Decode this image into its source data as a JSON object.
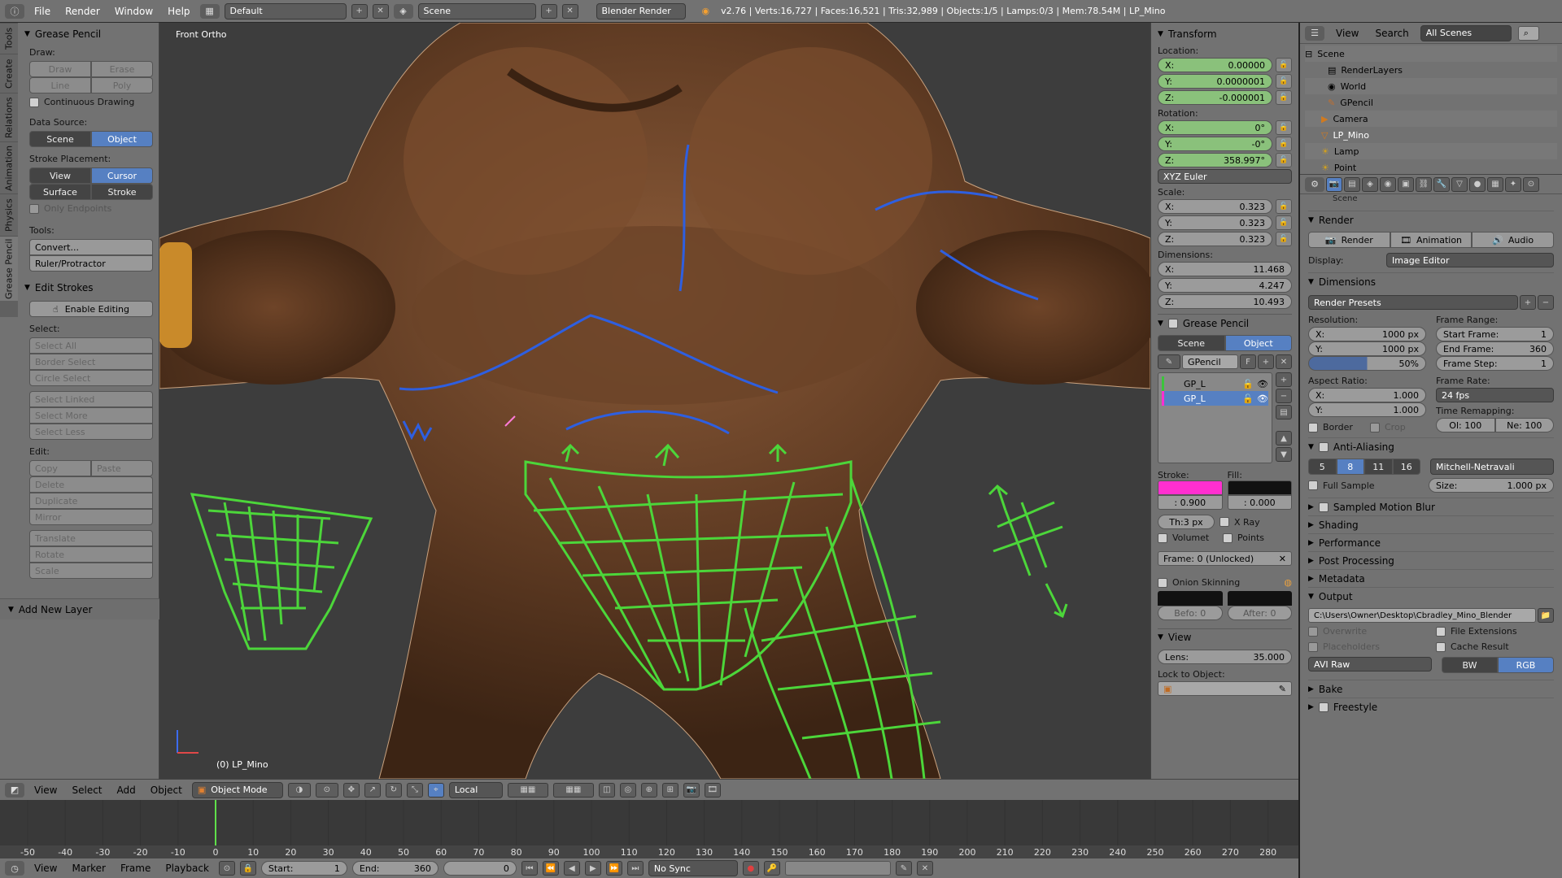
{
  "topbar": {
    "menus": [
      "File",
      "Render",
      "Window",
      "Help"
    ],
    "layout": "Default",
    "scene": "Scene",
    "engine": "Blender Render",
    "stats": "v2.76 | Verts:16,727 | Faces:16,521 | Tris:32,989 | Objects:1/5 | Lamps:0/3 | Mem:78.54M | LP_Mino"
  },
  "toolshelf": {
    "tabs": [
      "Tools",
      "Create",
      "Relations",
      "Animation",
      "Physics",
      "Grease Pencil"
    ],
    "panel_title": "Grease Pencil",
    "draw_label": "Draw:",
    "draw_buttons": [
      "Draw",
      "Erase",
      "Line",
      "Poly"
    ],
    "continuous_drawing": "Continuous Drawing",
    "data_source_label": "Data Source:",
    "data_source": [
      "Scene",
      "Object"
    ],
    "stroke_placement_label": "Stroke Placement:",
    "stroke_placement": [
      "View",
      "Cursor",
      "Surface",
      "Stroke"
    ],
    "only_endpoints": "Only Endpoints",
    "tools_label": "Tools:",
    "tools": [
      "Convert...",
      "Ruler/Protractor"
    ],
    "edit_strokes_title": "Edit Strokes",
    "enable_editing": "Enable Editing",
    "select_label": "Select:",
    "select_items": [
      "Select All",
      "Border Select",
      "Circle Select",
      "Select Linked",
      "Select More",
      "Select Less"
    ],
    "edit_label": "Edit:",
    "copy": "Copy",
    "paste": "Paste",
    "edit_items": [
      "Delete",
      "Duplicate",
      "Mirror",
      "Translate",
      "Rotate",
      "Scale"
    ],
    "add_new_layer": "Add New Layer"
  },
  "viewport": {
    "view_name": "Front Ortho",
    "object_label": "(0) LP_Mino"
  },
  "npanel": {
    "transform_title": "Transform",
    "location_label": "Location:",
    "location": [
      {
        "k": "X:",
        "v": "0.00000"
      },
      {
        "k": "Y:",
        "v": "0.0000001"
      },
      {
        "k": "Z:",
        "v": "-0.000001"
      }
    ],
    "rotation_label": "Rotation:",
    "rotation": [
      {
        "k": "X:",
        "v": "0°"
      },
      {
        "k": "Y:",
        "v": "-0°"
      },
      {
        "k": "Z:",
        "v": "358.997°"
      }
    ],
    "rotation_mode": "XYZ Euler",
    "scale_label": "Scale:",
    "scale": [
      {
        "k": "X:",
        "v": "0.323"
      },
      {
        "k": "Y:",
        "v": "0.323"
      },
      {
        "k": "Z:",
        "v": "0.323"
      }
    ],
    "dimensions_label": "Dimensions:",
    "dimensions": [
      {
        "k": "X:",
        "v": "11.468"
      },
      {
        "k": "Y:",
        "v": "4.247"
      },
      {
        "k": "Z:",
        "v": "10.493"
      }
    ],
    "gp_title": "Grease Pencil",
    "gp_source": [
      "Scene",
      "Object"
    ],
    "gp_name": "GPencil",
    "gp_f": "F",
    "layers": [
      "GP_L",
      "GP_L"
    ],
    "stroke_label": "Stroke:",
    "fill_label": "Fill:",
    "stroke_color": "#ff2fd0",
    "fill_color": "#111111",
    "stroke_alpha": ": 0.900",
    "fill_alpha": ": 0.000",
    "thickness": "Th:3 px",
    "xray": "X Ray",
    "volumetric": "Volumet",
    "points": "Points",
    "frame": "Frame: 0 (Unlocked)",
    "onion": "Onion Skinning",
    "before": "Befo: 0",
    "after": "After: 0",
    "view_title": "View",
    "lens": "Lens:",
    "lens_value": "35.000",
    "lock_to_object": "Lock to Object:"
  },
  "outliner": {
    "menus": [
      "View",
      "Search"
    ],
    "scenes": "All Scenes",
    "items": [
      "Scene",
      "RenderLayers",
      "World",
      "GPencil",
      "Camera",
      "LP_Mino",
      "Lamp",
      "Point"
    ]
  },
  "props": {
    "breadcrumb": "Scene",
    "render_title": "Render",
    "render_buttons": [
      "Render",
      "Animation",
      "Audio"
    ],
    "display_label": "Display:",
    "display": "Image Editor",
    "dimensions_title": "Dimensions",
    "presets": "Render Presets",
    "resolution_label": "Resolution:",
    "res_x": "1000 px",
    "res_y": "1000 px",
    "res_pct": "50%",
    "frame_range_label": "Frame Range:",
    "start_frame": "Start Frame:",
    "start_frame_val": "1",
    "end_frame": "End Frame:",
    "end_frame_val": "360",
    "frame_step": "Frame Step:",
    "frame_step_val": "1",
    "aspect_label": "Aspect Ratio:",
    "aspect_x": "1.000",
    "aspect_y": "1.000",
    "frame_rate_label": "Frame Rate:",
    "fps": "24 fps",
    "time_remap_label": "Time Remapping:",
    "ol": "Ol: 100",
    "ne": "Ne: 100",
    "border": "Border",
    "crop": "Crop",
    "aa_title": "Anti-Aliasing",
    "aa_samples": [
      "5",
      "8",
      "11",
      "16"
    ],
    "aa_filter": "Mitchell-Netravali",
    "full_sample": "Full Sample",
    "size_label": "Size:",
    "size_val": "1.000 px",
    "collapsed": [
      "Sampled Motion Blur",
      "Shading",
      "Performance",
      "Post Processing",
      "Metadata"
    ],
    "output_title": "Output",
    "output_path": "C:\\Users\\Owner\\Desktop\\Cbradley_Mino_Blender",
    "overwrite": "Overwrite",
    "file_ext": "File Extensions",
    "placeholders": "Placeholders",
    "cache": "Cache Result",
    "format": "AVI Raw",
    "bw": "BW",
    "rgb": "RGB",
    "bake": "Bake",
    "freestyle": "Freestyle"
  },
  "vpheader": {
    "menus": [
      "View",
      "Select",
      "Add",
      "Object"
    ],
    "mode": "Object Mode",
    "orientation": "Local"
  },
  "timeline": {
    "ticks": [
      "-50",
      "-40",
      "-30",
      "-20",
      "-10",
      "0",
      "10",
      "20",
      "30",
      "40",
      "50",
      "60",
      "70",
      "80",
      "90",
      "100",
      "110",
      "120",
      "130",
      "140",
      "150",
      "160",
      "170",
      "180",
      "190",
      "200",
      "210",
      "220",
      "230",
      "240",
      "250",
      "260",
      "270",
      "280"
    ],
    "current_frame": 0
  },
  "tlheader": {
    "menus": [
      "View",
      "Marker",
      "Frame",
      "Playback"
    ],
    "start": "Start:",
    "start_val": "1",
    "end": "End:",
    "end_val": "360",
    "current": "0",
    "sync": "No Sync"
  }
}
